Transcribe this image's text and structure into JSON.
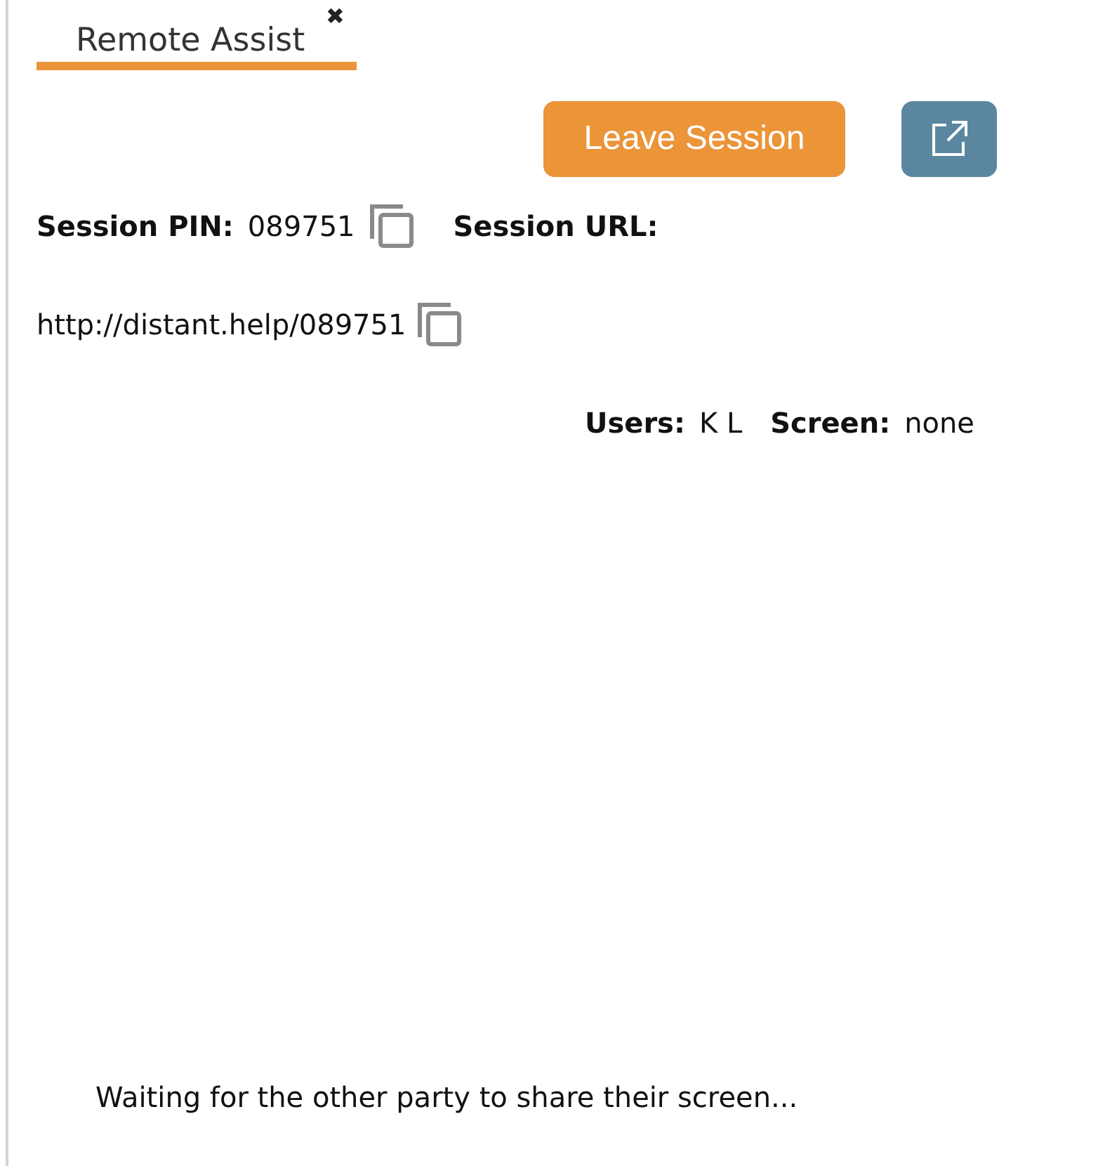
{
  "tabs": [
    {
      "label": "Remote Assist",
      "close": "✖",
      "selected": true
    }
  ],
  "leave_button": "Leave Session",
  "session": {
    "pin_label": "Session PIN:",
    "pin": "089751",
    "url_label": "Session URL:",
    "url": "http://distant.help/089751"
  },
  "status": {
    "users_label": "Users:",
    "users": "K L",
    "screen_label": "Screen:",
    "screen": "none"
  },
  "message": "Waiting for the other party to share their screen..."
}
